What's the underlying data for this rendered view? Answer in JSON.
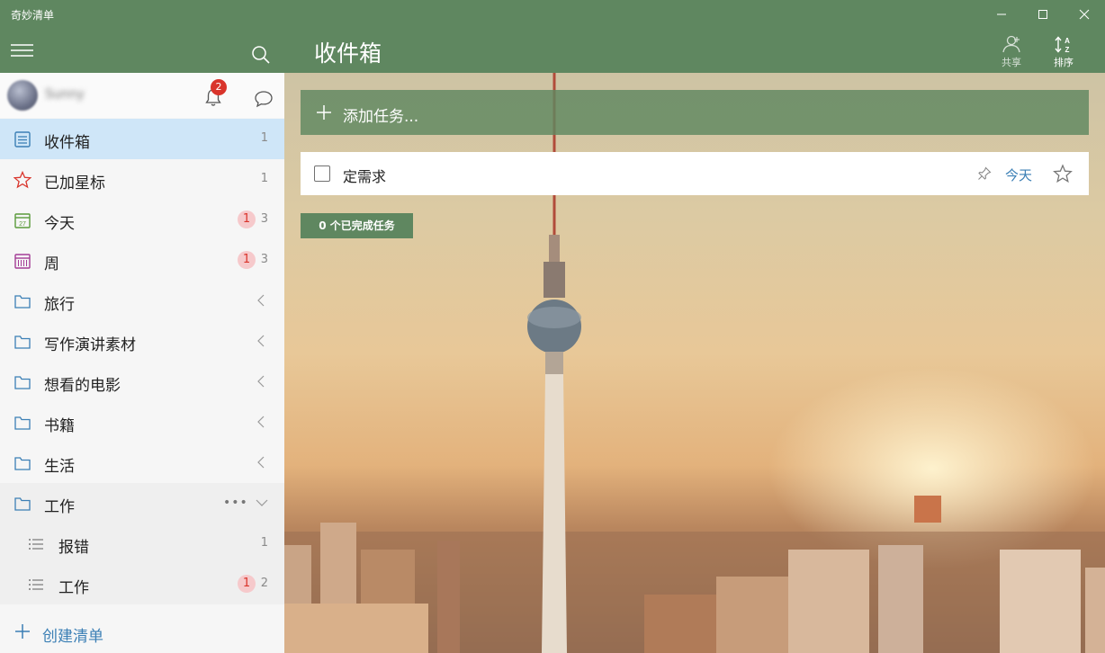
{
  "window": {
    "title": "奇妙清单"
  },
  "sidebar": {
    "user": {
      "name": "Sunny",
      "notification_count": "2"
    },
    "items": [
      {
        "label": "收件箱",
        "count": "1",
        "icon": "inbox-icon"
      },
      {
        "label": "已加星标",
        "count": "1",
        "icon": "star-icon"
      },
      {
        "label": "今天",
        "overdue": "1",
        "count": "3",
        "icon": "calendar-today-icon",
        "calendar_day": "27"
      },
      {
        "label": "周",
        "overdue": "1",
        "count": "3",
        "icon": "calendar-week-icon"
      },
      {
        "label": "旅行",
        "icon": "folder-icon"
      },
      {
        "label": "写作演讲素材",
        "icon": "folder-icon"
      },
      {
        "label": "想看的电影",
        "icon": "folder-icon"
      },
      {
        "label": "书籍",
        "icon": "folder-icon"
      },
      {
        "label": "生活",
        "icon": "folder-icon"
      },
      {
        "label": "工作",
        "icon": "folder-icon",
        "more": "•••"
      },
      {
        "label": "报错",
        "count": "1",
        "icon": "list-icon"
      },
      {
        "label": "工作",
        "overdue": "1",
        "count": "2",
        "icon": "list-icon"
      }
    ],
    "create_list_label": "创建清单"
  },
  "main": {
    "title": "收件箱",
    "share_label": "共享",
    "sort_label": "排序",
    "add_task_placeholder": "添加任务...",
    "tasks": [
      {
        "title": "定需求",
        "due": "今天",
        "starred": false
      }
    ],
    "completed_label": "0 个已完成任务"
  },
  "colors": {
    "brand_green": "#5f8760",
    "active_blue": "#cfe6f8",
    "link_blue": "#3b7fb5",
    "overdue_red": "#d9342b"
  }
}
